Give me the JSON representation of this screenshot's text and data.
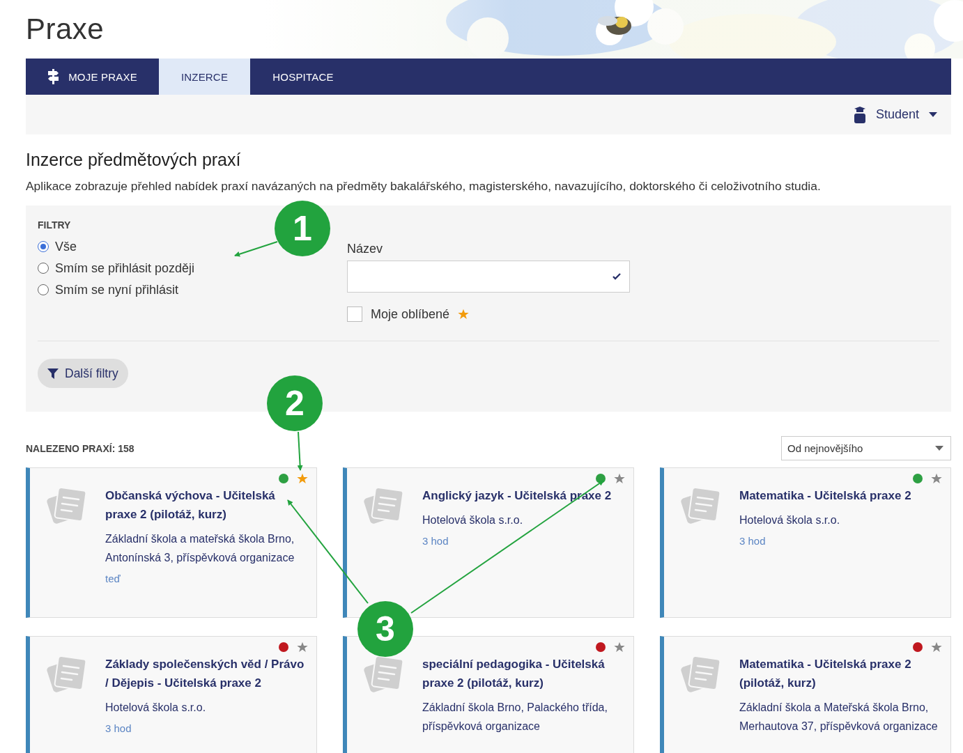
{
  "header": {
    "title": "Praxe"
  },
  "nav": {
    "tabs": [
      {
        "label": "MOJE PRAXE",
        "selected": false,
        "kind": "icon"
      },
      {
        "label": "INZERCE",
        "selected": true,
        "kind": "plain"
      },
      {
        "label": "HOSPITACE",
        "selected": false,
        "kind": "plain"
      }
    ]
  },
  "role_menu": {
    "label": "Student"
  },
  "page": {
    "heading": "Inzerce předmětových praxí",
    "description": "Aplikace zobrazuje přehled nabídek praxí navázaných na předměty bakalářského, magisterského, navazujícího, doktorského či celoživotního studia."
  },
  "filters": {
    "title": "FILTRY",
    "options": [
      {
        "label": "Vše",
        "selected": true
      },
      {
        "label": "Smím se přihlásit později",
        "selected": false
      },
      {
        "label": "Smím se nyní přihlásit",
        "selected": false
      }
    ],
    "name_field": {
      "label": "Název"
    },
    "favorites": {
      "label": "Moje oblíbené",
      "checked": false
    },
    "more_button": "Další filtry"
  },
  "results": {
    "count": "NALEZENO PRAXÍ: 158",
    "sort": {
      "value": "Od nejnovějšího"
    },
    "cards": [
      {
        "title": "Občanská výchova - Učitelská praxe 2 (pilotáž, kurz)",
        "school": "Základní škola a mateřská škola Brno, Antonínská 3, příspěvková organizace",
        "meta": "teď",
        "color": "#2ea043",
        "favorite": true
      },
      {
        "title": "Anglický jazyk - Učitelská praxe 2",
        "school": "Hotelová škola s.r.o.",
        "meta": "3 hod",
        "color": "#2ea043",
        "favorite": false
      },
      {
        "title": "Matematika - Učitelská praxe 2",
        "school": "Hotelová škola s.r.o.",
        "meta": "3 hod",
        "color": "#2ea043",
        "favorite": false
      },
      {
        "title": "Základy společenských věd / Právo / Dějepis - Učitelská praxe 2",
        "school": "Hotelová škola s.r.o.",
        "meta": "3 hod",
        "color": "#c0181f",
        "favorite": false
      },
      {
        "title": "speciální pedagogika - Učitelská praxe 2 (pilotáž, kurz)",
        "school": "Základní škola Brno, Palackého třída, příspěvková organizace",
        "color": "#c0181f",
        "favorite": false
      },
      {
        "title": "Matematika - Učitelská praxe 2 (pilotáž, kurz)",
        "school": "Základní škola a Mateřská škola Brno, Merhautova 37, příspěvková organizace",
        "color": "#c0181f",
        "favorite": false
      }
    ]
  },
  "annotations": [
    {
      "number": "1"
    },
    {
      "number": "2"
    },
    {
      "number": "3"
    }
  ]
}
